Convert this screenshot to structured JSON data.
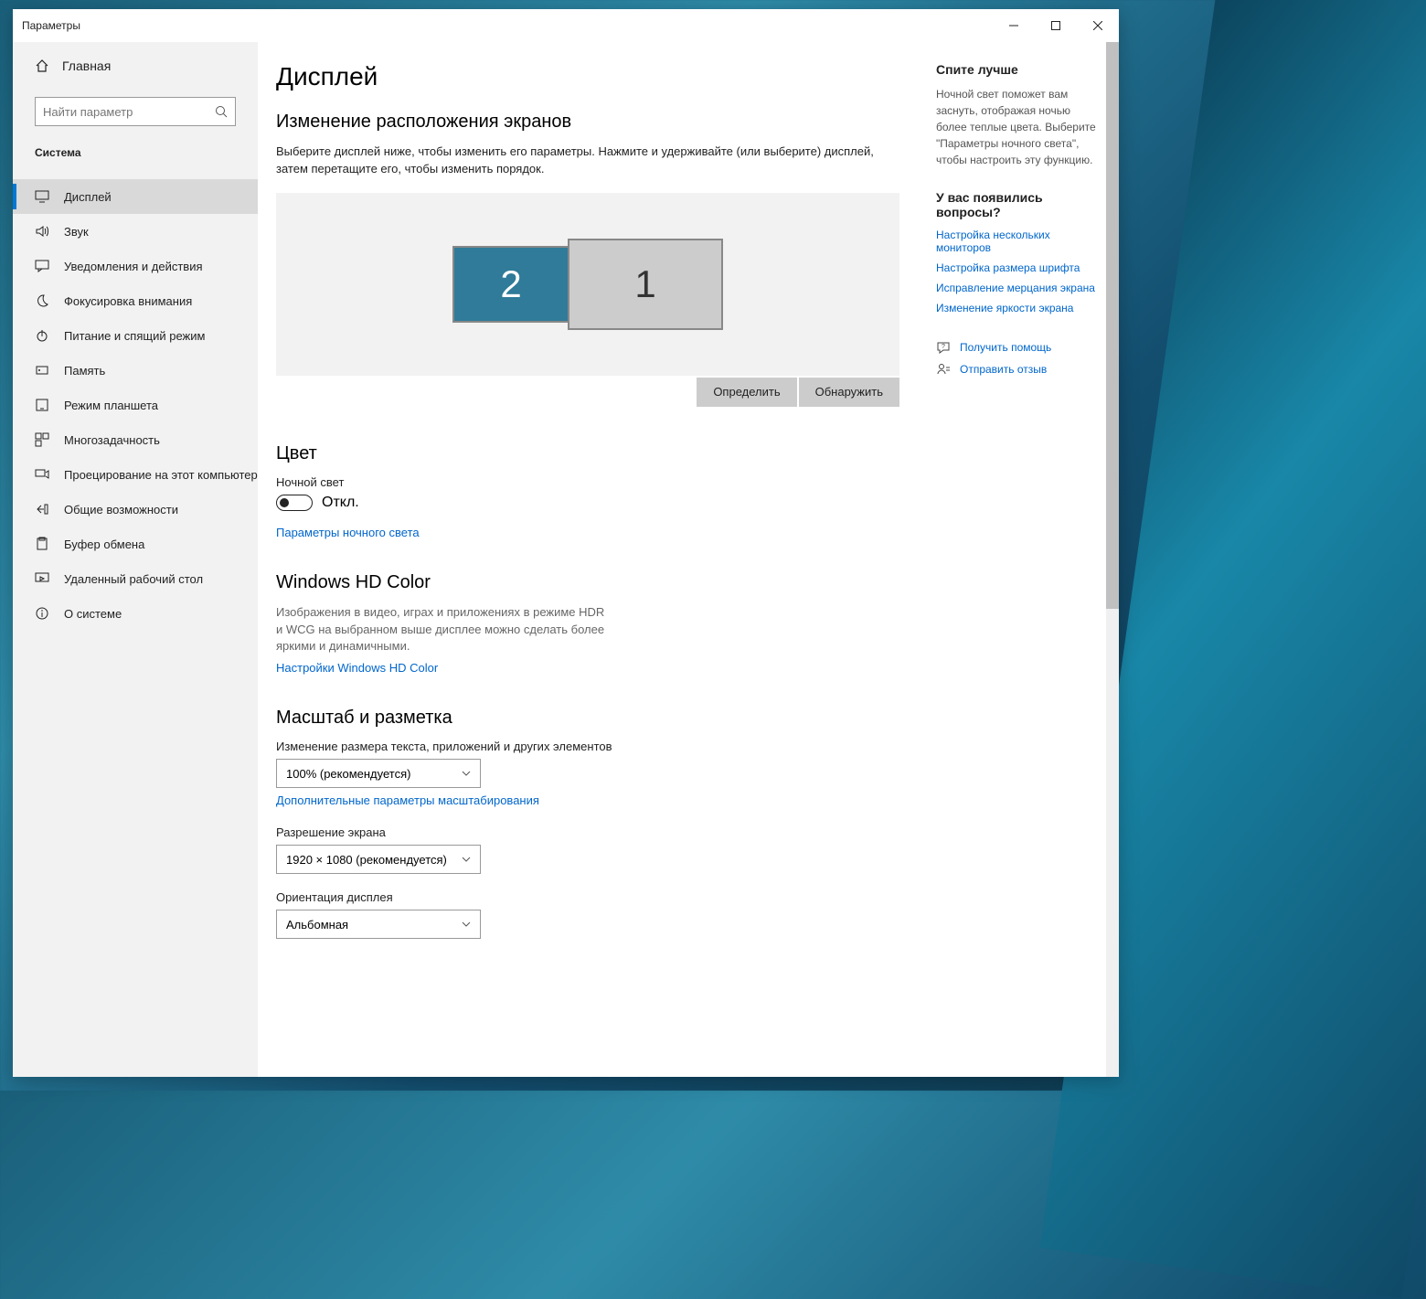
{
  "window": {
    "title": "Параметры"
  },
  "sidebar": {
    "home": "Главная",
    "search_placeholder": "Найти параметр",
    "group": "Система",
    "items": [
      {
        "label": "Дисплей",
        "icon": "monitor"
      },
      {
        "label": "Звук",
        "icon": "sound"
      },
      {
        "label": "Уведомления и действия",
        "icon": "chat"
      },
      {
        "label": "Фокусировка внимания",
        "icon": "moon"
      },
      {
        "label": "Питание и спящий режим",
        "icon": "power"
      },
      {
        "label": "Память",
        "icon": "storage"
      },
      {
        "label": "Режим планшета",
        "icon": "tablet"
      },
      {
        "label": "Многозадачность",
        "icon": "multitask"
      },
      {
        "label": "Проецирование на этот компьютер",
        "icon": "project"
      },
      {
        "label": "Общие возможности",
        "icon": "share"
      },
      {
        "label": "Буфер обмена",
        "icon": "clipboard"
      },
      {
        "label": "Удаленный рабочий стол",
        "icon": "remote"
      },
      {
        "label": "О системе",
        "icon": "info"
      }
    ]
  },
  "page": {
    "title": "Дисплей",
    "arrange": {
      "heading": "Изменение расположения экранов",
      "desc": "Выберите дисплей ниже, чтобы изменить его параметры. Нажмите и удерживайте (или выберите) дисплей, затем перетащите его, чтобы изменить порядок.",
      "monitors": [
        {
          "id": "2",
          "selected": false
        },
        {
          "id": "1",
          "selected": true
        }
      ],
      "identify": "Определить",
      "detect": "Обнаружить"
    },
    "color": {
      "heading": "Цвет",
      "night_label": "Ночной свет",
      "toggle_state": "Откл.",
      "night_link": "Параметры ночного света"
    },
    "hdcolor": {
      "heading": "Windows HD Color",
      "desc": "Изображения в видео, играх и приложениях в режиме HDR и WCG на выбранном выше дисплее можно сделать более яркими и динамичными.",
      "link": "Настройки Windows HD Color"
    },
    "scale": {
      "heading": "Масштаб и разметка",
      "scale_label": "Изменение размера текста, приложений и других элементов",
      "scale_value": "100% (рекомендуется)",
      "advanced_link": "Дополнительные параметры масштабирования",
      "res_label": "Разрешение экрана",
      "res_value": "1920 × 1080 (рекомендуется)",
      "orient_label": "Ориентация дисплея",
      "orient_value": "Альбомная"
    }
  },
  "aside": {
    "sleep_heading": "Спите лучше",
    "sleep_text": "Ночной свет поможет вам заснуть, отображая ночью более теплые цвета. Выберите \"Параметры ночного света\", чтобы настроить эту функцию.",
    "questions_heading": "У вас появились вопросы?",
    "links": [
      "Настройка нескольких мониторов",
      "Настройка размера шрифта",
      "Исправление мерцания экрана",
      "Изменение яркости экрана"
    ],
    "get_help": "Получить помощь",
    "feedback": "Отправить отзыв"
  }
}
